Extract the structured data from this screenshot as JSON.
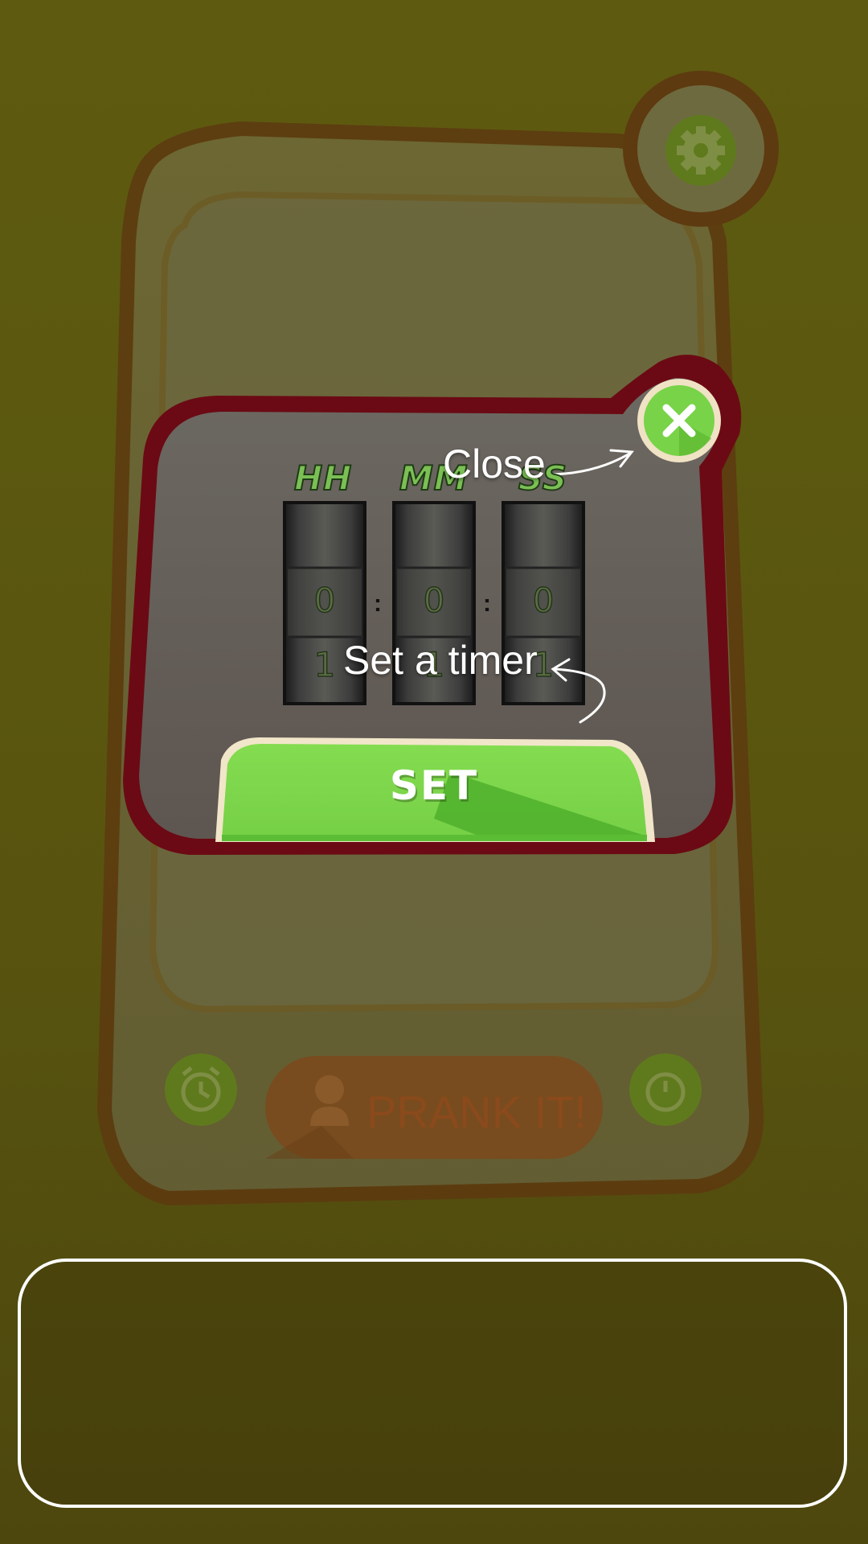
{
  "timer": {
    "labels": {
      "hours": "HH",
      "minutes": "MM",
      "seconds": "SS"
    },
    "values": {
      "hours": "0",
      "minutes": "0",
      "seconds": "0"
    },
    "next_values": {
      "hours": "1",
      "minutes": "1",
      "seconds": "1"
    },
    "separator": ":"
  },
  "buttons": {
    "set_label": "SET",
    "prank_label": "PRANK IT!"
  },
  "tutorial": {
    "close_hint": "Close",
    "timer_hint": "Set a timer"
  },
  "icons": {
    "settings": "gear-icon",
    "close": "close-icon",
    "alarm": "alarm-clock-icon",
    "timer": "stopwatch-icon",
    "person": "person-icon"
  },
  "colors": {
    "overlay": "#5d5a10",
    "dialog_border": "#6b0a14",
    "dialog_fill": "#6a625a",
    "accent_green": "#7ed64a",
    "dark_green": "#4cae2a",
    "prank_orange": "#7a4a1c",
    "phone_outline": "#5e3a10"
  }
}
